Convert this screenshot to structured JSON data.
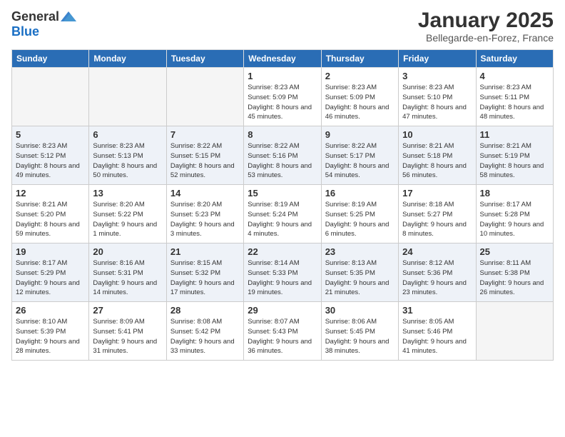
{
  "logo": {
    "general": "General",
    "blue": "Blue"
  },
  "title": "January 2025",
  "location": "Bellegarde-en-Forez, France",
  "headers": [
    "Sunday",
    "Monday",
    "Tuesday",
    "Wednesday",
    "Thursday",
    "Friday",
    "Saturday"
  ],
  "weeks": [
    [
      {
        "day": "",
        "sunrise": "",
        "sunset": "",
        "daylight": ""
      },
      {
        "day": "",
        "sunrise": "",
        "sunset": "",
        "daylight": ""
      },
      {
        "day": "",
        "sunrise": "",
        "sunset": "",
        "daylight": ""
      },
      {
        "day": "1",
        "sunrise": "Sunrise: 8:23 AM",
        "sunset": "Sunset: 5:09 PM",
        "daylight": "Daylight: 8 hours and 45 minutes."
      },
      {
        "day": "2",
        "sunrise": "Sunrise: 8:23 AM",
        "sunset": "Sunset: 5:09 PM",
        "daylight": "Daylight: 8 hours and 46 minutes."
      },
      {
        "day": "3",
        "sunrise": "Sunrise: 8:23 AM",
        "sunset": "Sunset: 5:10 PM",
        "daylight": "Daylight: 8 hours and 47 minutes."
      },
      {
        "day": "4",
        "sunrise": "Sunrise: 8:23 AM",
        "sunset": "Sunset: 5:11 PM",
        "daylight": "Daylight: 8 hours and 48 minutes."
      }
    ],
    [
      {
        "day": "5",
        "sunrise": "Sunrise: 8:23 AM",
        "sunset": "Sunset: 5:12 PM",
        "daylight": "Daylight: 8 hours and 49 minutes."
      },
      {
        "day": "6",
        "sunrise": "Sunrise: 8:23 AM",
        "sunset": "Sunset: 5:13 PM",
        "daylight": "Daylight: 8 hours and 50 minutes."
      },
      {
        "day": "7",
        "sunrise": "Sunrise: 8:22 AM",
        "sunset": "Sunset: 5:15 PM",
        "daylight": "Daylight: 8 hours and 52 minutes."
      },
      {
        "day": "8",
        "sunrise": "Sunrise: 8:22 AM",
        "sunset": "Sunset: 5:16 PM",
        "daylight": "Daylight: 8 hours and 53 minutes."
      },
      {
        "day": "9",
        "sunrise": "Sunrise: 8:22 AM",
        "sunset": "Sunset: 5:17 PM",
        "daylight": "Daylight: 8 hours and 54 minutes."
      },
      {
        "day": "10",
        "sunrise": "Sunrise: 8:21 AM",
        "sunset": "Sunset: 5:18 PM",
        "daylight": "Daylight: 8 hours and 56 minutes."
      },
      {
        "day": "11",
        "sunrise": "Sunrise: 8:21 AM",
        "sunset": "Sunset: 5:19 PM",
        "daylight": "Daylight: 8 hours and 58 minutes."
      }
    ],
    [
      {
        "day": "12",
        "sunrise": "Sunrise: 8:21 AM",
        "sunset": "Sunset: 5:20 PM",
        "daylight": "Daylight: 8 hours and 59 minutes."
      },
      {
        "day": "13",
        "sunrise": "Sunrise: 8:20 AM",
        "sunset": "Sunset: 5:22 PM",
        "daylight": "Daylight: 9 hours and 1 minute."
      },
      {
        "day": "14",
        "sunrise": "Sunrise: 8:20 AM",
        "sunset": "Sunset: 5:23 PM",
        "daylight": "Daylight: 9 hours and 3 minutes."
      },
      {
        "day": "15",
        "sunrise": "Sunrise: 8:19 AM",
        "sunset": "Sunset: 5:24 PM",
        "daylight": "Daylight: 9 hours and 4 minutes."
      },
      {
        "day": "16",
        "sunrise": "Sunrise: 8:19 AM",
        "sunset": "Sunset: 5:25 PM",
        "daylight": "Daylight: 9 hours and 6 minutes."
      },
      {
        "day": "17",
        "sunrise": "Sunrise: 8:18 AM",
        "sunset": "Sunset: 5:27 PM",
        "daylight": "Daylight: 9 hours and 8 minutes."
      },
      {
        "day": "18",
        "sunrise": "Sunrise: 8:17 AM",
        "sunset": "Sunset: 5:28 PM",
        "daylight": "Daylight: 9 hours and 10 minutes."
      }
    ],
    [
      {
        "day": "19",
        "sunrise": "Sunrise: 8:17 AM",
        "sunset": "Sunset: 5:29 PM",
        "daylight": "Daylight: 9 hours and 12 minutes."
      },
      {
        "day": "20",
        "sunrise": "Sunrise: 8:16 AM",
        "sunset": "Sunset: 5:31 PM",
        "daylight": "Daylight: 9 hours and 14 minutes."
      },
      {
        "day": "21",
        "sunrise": "Sunrise: 8:15 AM",
        "sunset": "Sunset: 5:32 PM",
        "daylight": "Daylight: 9 hours and 17 minutes."
      },
      {
        "day": "22",
        "sunrise": "Sunrise: 8:14 AM",
        "sunset": "Sunset: 5:33 PM",
        "daylight": "Daylight: 9 hours and 19 minutes."
      },
      {
        "day": "23",
        "sunrise": "Sunrise: 8:13 AM",
        "sunset": "Sunset: 5:35 PM",
        "daylight": "Daylight: 9 hours and 21 minutes."
      },
      {
        "day": "24",
        "sunrise": "Sunrise: 8:12 AM",
        "sunset": "Sunset: 5:36 PM",
        "daylight": "Daylight: 9 hours and 23 minutes."
      },
      {
        "day": "25",
        "sunrise": "Sunrise: 8:11 AM",
        "sunset": "Sunset: 5:38 PM",
        "daylight": "Daylight: 9 hours and 26 minutes."
      }
    ],
    [
      {
        "day": "26",
        "sunrise": "Sunrise: 8:10 AM",
        "sunset": "Sunset: 5:39 PM",
        "daylight": "Daylight: 9 hours and 28 minutes."
      },
      {
        "day": "27",
        "sunrise": "Sunrise: 8:09 AM",
        "sunset": "Sunset: 5:41 PM",
        "daylight": "Daylight: 9 hours and 31 minutes."
      },
      {
        "day": "28",
        "sunrise": "Sunrise: 8:08 AM",
        "sunset": "Sunset: 5:42 PM",
        "daylight": "Daylight: 9 hours and 33 minutes."
      },
      {
        "day": "29",
        "sunrise": "Sunrise: 8:07 AM",
        "sunset": "Sunset: 5:43 PM",
        "daylight": "Daylight: 9 hours and 36 minutes."
      },
      {
        "day": "30",
        "sunrise": "Sunrise: 8:06 AM",
        "sunset": "Sunset: 5:45 PM",
        "daylight": "Daylight: 9 hours and 38 minutes."
      },
      {
        "day": "31",
        "sunrise": "Sunrise: 8:05 AM",
        "sunset": "Sunset: 5:46 PM",
        "daylight": "Daylight: 9 hours and 41 minutes."
      },
      {
        "day": "",
        "sunrise": "",
        "sunset": "",
        "daylight": ""
      }
    ]
  ]
}
